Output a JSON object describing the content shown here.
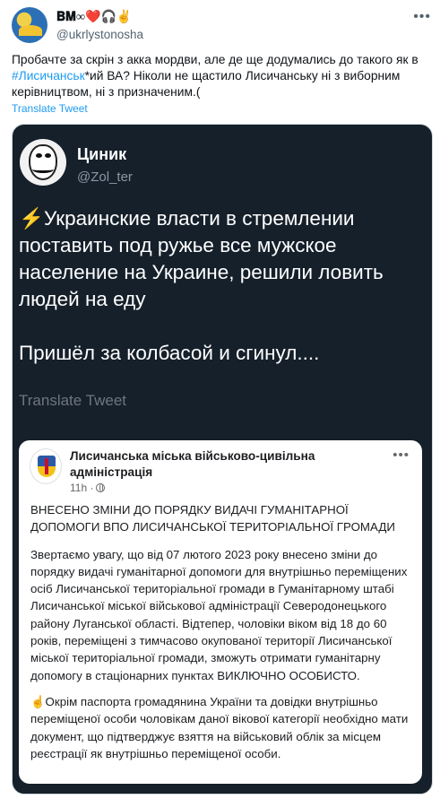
{
  "tweet": {
    "display_name": "𝐁𝐌∞❤️🎧✌",
    "handle": "@ukrlystonosha",
    "more_icon": "more-horizontal-icon",
    "text_before": "Пробачте за скрін з акка мордви, але де ще додумались до такого як в ",
    "hashtag": "#Лисичанськ",
    "text_after": "*ий ВА? Ніколи не щастило Лисичанську ні з виборним керівництвом, ні з призначеним.(",
    "translate_label": "Translate Tweet"
  },
  "quoted": {
    "name": "Циник",
    "handle": "@Zol_ter",
    "paragraph1": "⚡Украинские власти в стремлении поставить под ружье все мужское население на Украине, решили ловить людей на еду",
    "paragraph2": "Пришёл за колбасой и сгинул....",
    "translate_label": "Translate Tweet"
  },
  "fb_post": {
    "page_name": "Лисичанська міська військово-цивільна адміністрація",
    "time": "11h ·",
    "heading": "ВНЕСЕНО ЗМІНИ ДО ПОРЯДКУ ВИДАЧІ ГУМАНІТАРНОЇ ДОПОМОГИ ВПО  ЛИСИЧАНСЬКОЇ ТЕРИТОРІАЛЬНОЇ ГРОМАДИ",
    "paragraph1": "Звертаємо увагу, що від 07 лютого 2023 року внесено зміни до порядку видачі гуманітарної допомоги для внутрішньо переміщених осіб Лисичанської територіальної громади в Гуманітарному штабі Лисичанської міської військової адміністрації Северодонецького району Луганської області. Відтепер, чоловіки віком від 18 до 60 років, переміщені з тимчасово окупованої території Лисичанської міської територіальної громади, зможуть отримати гуманітарну допомогу в стаціонарних пунктах ВИКЛЮЧНО ОСОБИСТО.",
    "paragraph2": "☝Окрім паспорта громадянина України та довідки внутрішньо переміщеної особи чоловікам даної вікової категорії необхідно мати документ, що підтверджує взяття на військовий облік за місцем реєстрації як внутрішньо переміщеної особи."
  },
  "colors": {
    "link": "#1d9bf0",
    "dark_bg": "#15202b",
    "muted": "#536471"
  }
}
